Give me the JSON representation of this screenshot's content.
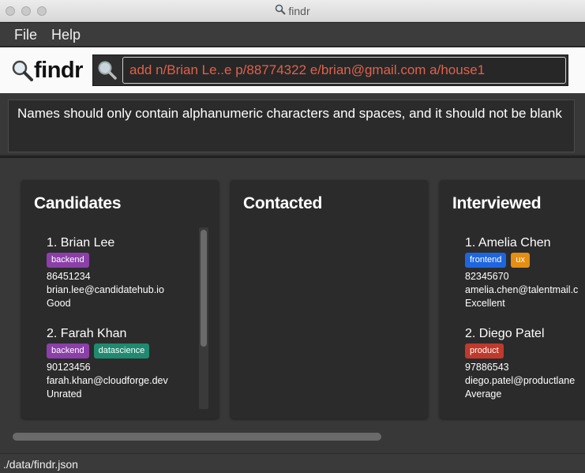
{
  "window": {
    "title": "findr"
  },
  "menu": {
    "file": "File",
    "help": "Help"
  },
  "logo": {
    "text": "findr"
  },
  "command": {
    "value": "add n/Brian Le..e p/88774322 e/brian@gmail.com a/house1"
  },
  "result": {
    "message": "Names should only contain alphanumeric characters and spaces, and it should not be blank"
  },
  "columns": [
    {
      "title": "Candidates",
      "cards": [
        {
          "name": "1. Brian Lee",
          "tags": [
            {
              "label": "backend",
              "color": "#8b3fa8"
            }
          ],
          "phone": "86451234",
          "email": "brian.lee@candidatehub.io",
          "rating": "Good"
        },
        {
          "name": "2. Farah Khan",
          "tags": [
            {
              "label": "backend",
              "color": "#8b3fa8"
            },
            {
              "label": "datascience",
              "color": "#1f8a70"
            }
          ],
          "phone": "90123456",
          "email": "farah.khan@cloudforge.dev",
          "rating": "Unrated"
        }
      ]
    },
    {
      "title": "Contacted",
      "cards": []
    },
    {
      "title": "Interviewed",
      "cards": [
        {
          "name": "1. Amelia Chen",
          "tags": [
            {
              "label": "frontend",
              "color": "#1e66e0"
            },
            {
              "label": "ux",
              "color": "#e58e12"
            }
          ],
          "phone": "82345670",
          "email": "amelia.chen@talentmail.c",
          "rating": "Excellent"
        },
        {
          "name": "2. Diego Patel",
          "tags": [
            {
              "label": "product",
              "color": "#c0392b"
            }
          ],
          "phone": "97886543",
          "email": "diego.patel@productlane",
          "rating": "Average"
        }
      ]
    }
  ],
  "status": {
    "path": "./data/findr.json"
  },
  "icons": {
    "search": "magnifier-icon"
  }
}
